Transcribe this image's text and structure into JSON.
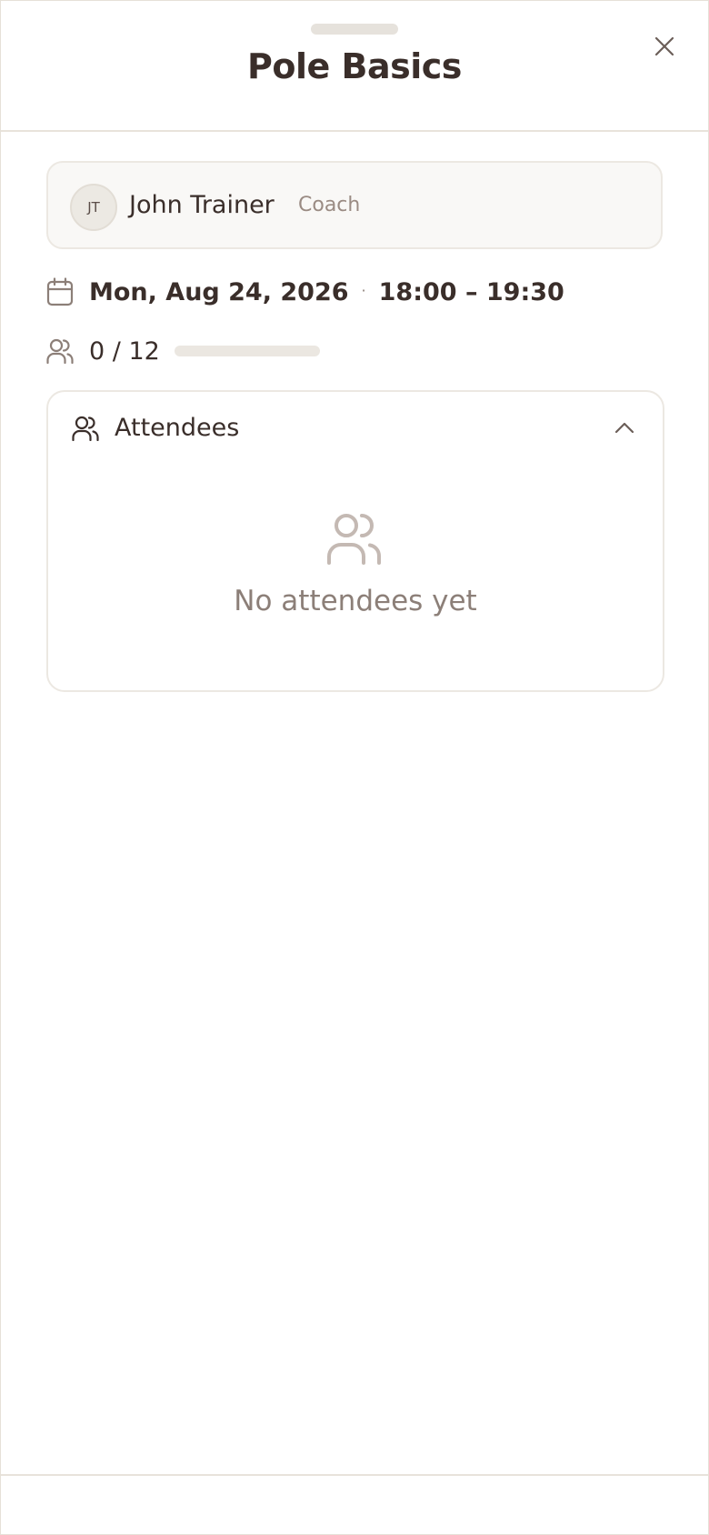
{
  "sheet": {
    "title": "Pole Basics"
  },
  "coach": {
    "initials": "JT",
    "name": "John Trainer",
    "role": "Coach"
  },
  "schedule": {
    "date": "Mon, Aug 24, 2026",
    "separator": "·",
    "time": "18:00 – 19:30"
  },
  "capacity": {
    "text": "0 / 12",
    "booked": 0,
    "total": 12,
    "fill_fraction": 0
  },
  "attendees": {
    "title": "Attendees",
    "expanded": true,
    "empty_message": "No attendees yet"
  },
  "icons": {
    "close": "close-icon",
    "calendar": "calendar-icon",
    "users": "users-icon",
    "chevron": "chevron-up-icon"
  },
  "colors": {
    "text_primary": "#3a2e2a",
    "text_muted": "#8c7f78",
    "icon_muted": "#c4b9b3",
    "border": "#ece8e2",
    "card_bg": "#f9f8f6"
  }
}
